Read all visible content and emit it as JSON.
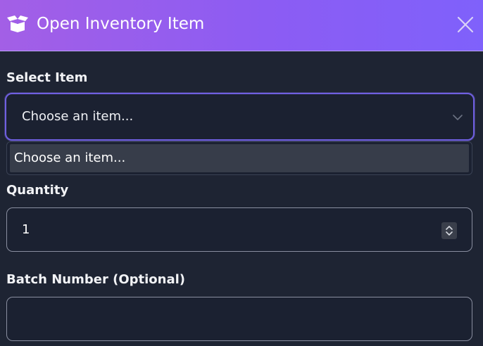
{
  "header": {
    "icon": "open-box-icon",
    "title": "Open Inventory Item",
    "close_icon": "close-icon"
  },
  "form": {
    "select_item": {
      "label": "Select Item",
      "value": "Choose an item...",
      "options": [
        "Choose an item..."
      ]
    },
    "quantity": {
      "label": "Quantity",
      "value": "1"
    },
    "batch_number": {
      "label": "Batch Number (Optional)",
      "value": ""
    }
  },
  "colors": {
    "header_gradient_start": "#a35fe6",
    "header_gradient_end": "#7f61fb",
    "background": "#1e2433",
    "focus_border": "#6f5fe0"
  }
}
